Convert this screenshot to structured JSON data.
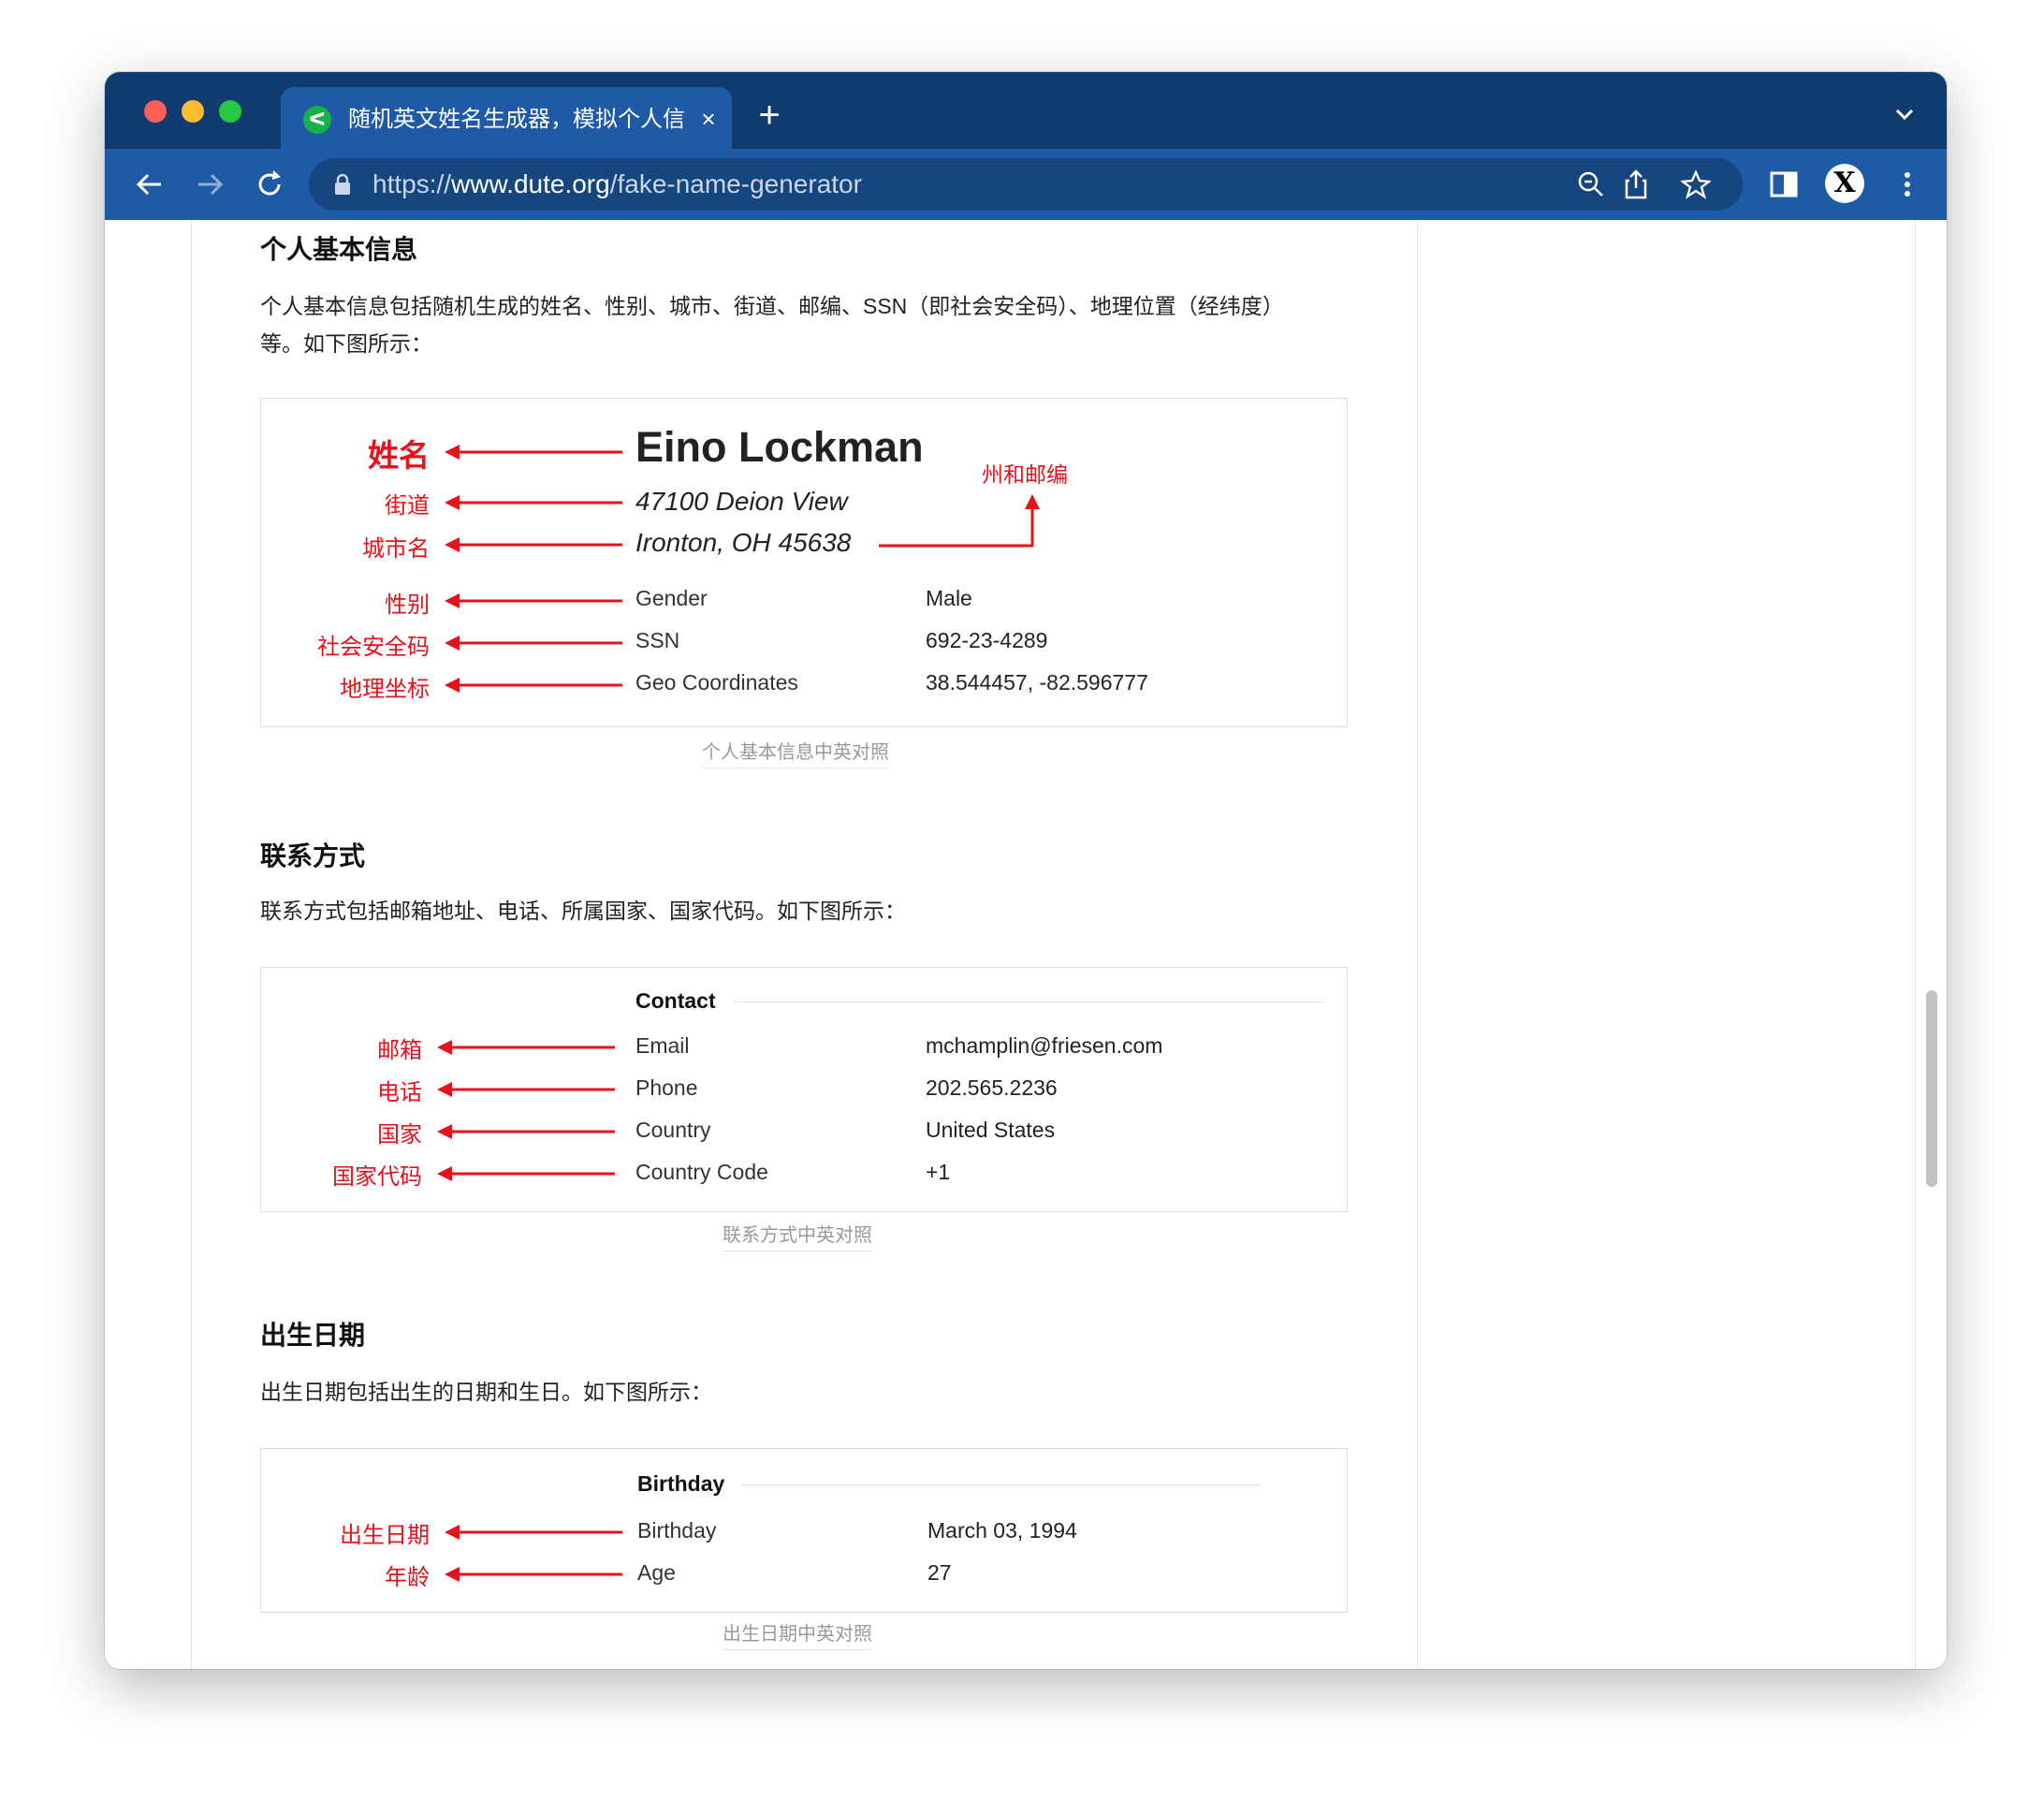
{
  "browser": {
    "tab_title": "随机英文姓名生成器，模拟个人信",
    "tab_close": "×",
    "new_tab": "+",
    "url_scheme": "https://",
    "url_host": "www.dute.org",
    "url_path": "/fake-name-generator",
    "profile_letter": "X",
    "colors": {
      "tabbar": "#0f3b6e",
      "toolbar": "#1f5aa6",
      "accent_red": "#e8101b"
    }
  },
  "section1": {
    "heading": "个人基本信息",
    "para_line1": "个人基本信息包括随机生成的姓名、性别、城市、街道、邮编、SSN（即社会安全码）、地理位置（经纬度）",
    "para_line2": "等。如下图所示：",
    "figure": {
      "name": "Eino Lockman",
      "street": "47100 Deion View",
      "city": "Ironton, OH 45638",
      "labels": {
        "name": "姓名",
        "street": "街道",
        "city": "城市名",
        "state_zip": "州和邮编",
        "gender": "性别",
        "ssn": "社会安全码",
        "geo": "地理坐标"
      },
      "rows": [
        {
          "label": "Gender",
          "value": "Male"
        },
        {
          "label": "SSN",
          "value": "692-23-4289"
        },
        {
          "label": "Geo Coordinates",
          "value": "38.544457, -82.596777"
        }
      ]
    },
    "caption": "个人基本信息中英对照"
  },
  "section2": {
    "heading": "联系方式",
    "para": "联系方式包括邮箱地址、电话、所属国家、国家代码。如下图所示：",
    "figure": {
      "title": "Contact",
      "labels": [
        "邮箱",
        "电话",
        "国家",
        "国家代码"
      ],
      "rows": [
        {
          "label": "Email",
          "value": "mchamplin@friesen.com"
        },
        {
          "label": "Phone",
          "value": "202.565.2236"
        },
        {
          "label": "Country",
          "value": "United States"
        },
        {
          "label": "Country Code",
          "value": "+1"
        }
      ]
    },
    "caption": "联系方式中英对照"
  },
  "section3": {
    "heading": "出生日期",
    "para": "出生日期包括出生的日期和生日。如下图所示：",
    "figure": {
      "title": "Birthday",
      "labels": [
        "出生日期",
        "年龄"
      ],
      "rows": [
        {
          "label": "Birthday",
          "value": "March 03, 1994"
        },
        {
          "label": "Age",
          "value": "27"
        }
      ]
    },
    "caption": "出生日期中英对照"
  }
}
